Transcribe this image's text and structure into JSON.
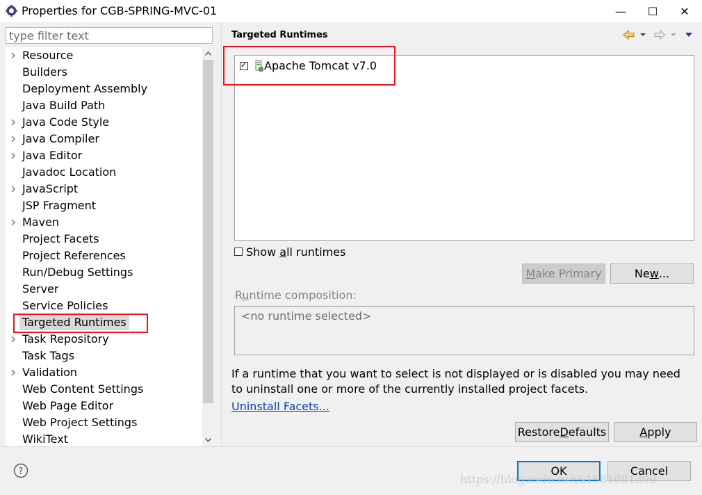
{
  "window": {
    "title": "Properties for CGB-SPRING-MVC-01",
    "minimize_glyph": "—",
    "maximize_glyph": "☐",
    "close_glyph": "✕"
  },
  "filter": {
    "placeholder": "type filter text",
    "value": ""
  },
  "tree": {
    "items": [
      {
        "label": "Resource",
        "expandable": true
      },
      {
        "label": "Builders",
        "expandable": false
      },
      {
        "label": "Deployment Assembly",
        "expandable": false
      },
      {
        "label": "Java Build Path",
        "expandable": false
      },
      {
        "label": "Java Code Style",
        "expandable": true
      },
      {
        "label": "Java Compiler",
        "expandable": true
      },
      {
        "label": "Java Editor",
        "expandable": true
      },
      {
        "label": "Javadoc Location",
        "expandable": false
      },
      {
        "label": "JavaScript",
        "expandable": true
      },
      {
        "label": "JSP Fragment",
        "expandable": false
      },
      {
        "label": "Maven",
        "expandable": true
      },
      {
        "label": "Project Facets",
        "expandable": false
      },
      {
        "label": "Project References",
        "expandable": false
      },
      {
        "label": "Run/Debug Settings",
        "expandable": false
      },
      {
        "label": "Server",
        "expandable": false
      },
      {
        "label": "Service Policies",
        "expandable": false
      },
      {
        "label": "Targeted Runtimes",
        "expandable": false,
        "selected": true
      },
      {
        "label": "Task Repository",
        "expandable": true
      },
      {
        "label": "Task Tags",
        "expandable": false
      },
      {
        "label": "Validation",
        "expandable": true
      },
      {
        "label": "Web Content Settings",
        "expandable": false
      },
      {
        "label": "Web Page Editor",
        "expandable": false
      },
      {
        "label": "Web Project Settings",
        "expandable": false
      },
      {
        "label": "WikiText",
        "expandable": false
      }
    ]
  },
  "page": {
    "title": "Targeted Runtimes",
    "runtimes": [
      {
        "label": "Apache Tomcat v7.0",
        "checked": true,
        "check_glyph": "✓"
      }
    ],
    "show_all": {
      "label_pre": "Show ",
      "label_mn": "a",
      "label_post": "ll runtimes",
      "checked": false
    },
    "make_primary": {
      "label_mn": "M",
      "label_post": "ake Primary"
    },
    "new_button": {
      "label_pre": "Ne",
      "label_mn": "w",
      "label_post": "..."
    },
    "composition": {
      "label_pre": "R",
      "label_mn": "u",
      "label_post": "ntime composition:",
      "value": "<no runtime selected>"
    },
    "info": "If a runtime that you want to select is not displayed or is disabled you may need to uninstall one or more of the currently installed project facets.",
    "uninstall_link": "Uninstall Facets...",
    "restore_defaults": {
      "label_pre": "Restore ",
      "label_mn": "D",
      "label_post": "efaults"
    },
    "apply": {
      "label_mn": "A",
      "label_post": "pply"
    }
  },
  "footer": {
    "help_glyph": "?",
    "ok": "OK",
    "cancel": "Cancel"
  },
  "watermark": "https://blog.csdn.net/s1581081399",
  "colors": {
    "annotation_red": "#e8141b",
    "link": "#0645ad",
    "default_button_border": "#0078d7"
  }
}
